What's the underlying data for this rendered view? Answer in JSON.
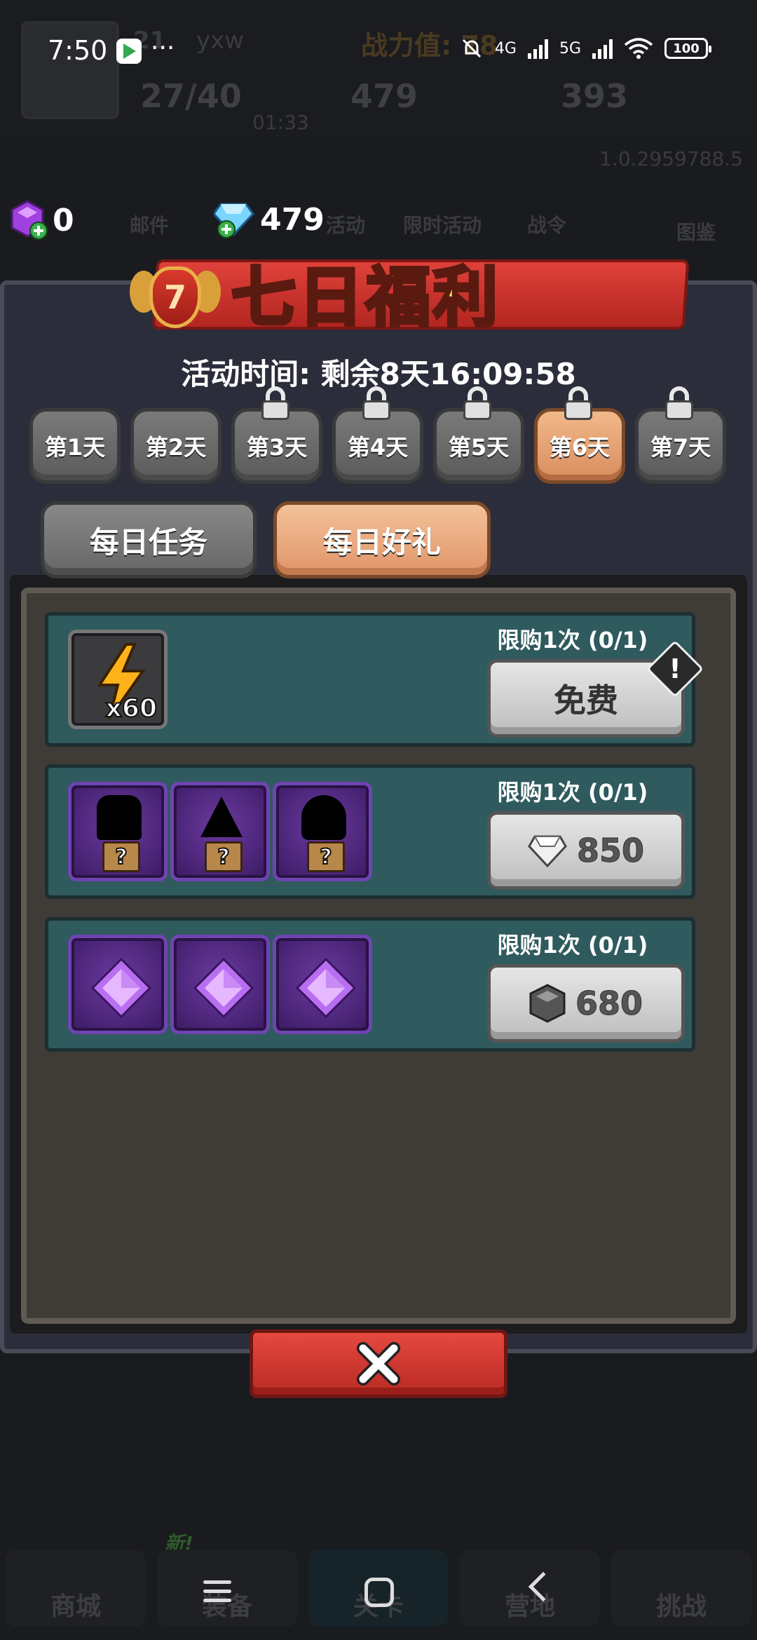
{
  "status_bar": {
    "time": "7:50",
    "network_1": "4G",
    "network_2": "5G",
    "battery": "100"
  },
  "background": {
    "level": "21",
    "player_name": "yxw",
    "power_label": "战力值: 78",
    "energy": "27/40",
    "energy_timer": "01:33",
    "gems": "479",
    "gold": "393",
    "version": "1.0.2959788.5",
    "icon_labels": [
      "邮件",
      "活动",
      "限时活动",
      "战令",
      "图鉴"
    ],
    "new_tag": "新!",
    "nav_items": [
      "商城",
      "装备",
      "关卡",
      "营地",
      "挑战"
    ]
  },
  "currency": {
    "purple_gems": "0",
    "diamonds": "479"
  },
  "event": {
    "title": "七日福利",
    "badge": "7",
    "timer": "活动时间: 剩余8天16:09:58"
  },
  "day_tabs": [
    {
      "label": "第1天",
      "locked": false,
      "active": false
    },
    {
      "label": "第2天",
      "locked": false,
      "active": false
    },
    {
      "label": "第3天",
      "locked": true,
      "active": false
    },
    {
      "label": "第4天",
      "locked": true,
      "active": false
    },
    {
      "label": "第5天",
      "locked": true,
      "active": false
    },
    {
      "label": "第6天",
      "locked": true,
      "active": true
    },
    {
      "label": "第7天",
      "locked": true,
      "active": false
    }
  ],
  "main_tabs": {
    "daily_tasks": "每日任务",
    "daily_gifts": "每日好礼"
  },
  "rewards": [
    {
      "limit": "限购1次 (0/1)",
      "button": "免费",
      "items": [
        {
          "icon": "energy-bolt-icon",
          "qty": "x60"
        }
      ]
    },
    {
      "limit": "限购1次 (0/1)",
      "price": "850",
      "currency_icon": "diamond-icon",
      "items": [
        {
          "icon": "mystery-helmet-chest-icon",
          "mark": "?"
        },
        {
          "icon": "mystery-hat-chest-icon",
          "mark": "?"
        },
        {
          "icon": "mystery-hood-chest-icon",
          "mark": "?"
        }
      ]
    },
    {
      "limit": "限购1次 (0/1)",
      "price": "680",
      "currency_icon": "stone-icon",
      "items": [
        {
          "icon": "purple-gem-icon"
        },
        {
          "icon": "purple-gem-icon"
        },
        {
          "icon": "purple-gem-icon"
        }
      ]
    }
  ],
  "colors": {
    "title_yellow": "#ffe24a",
    "ribbon_red": "#e0413a",
    "row_teal": "#2f5a5e",
    "active_tab": "#f2b88a",
    "close_red": "#e5483f"
  }
}
